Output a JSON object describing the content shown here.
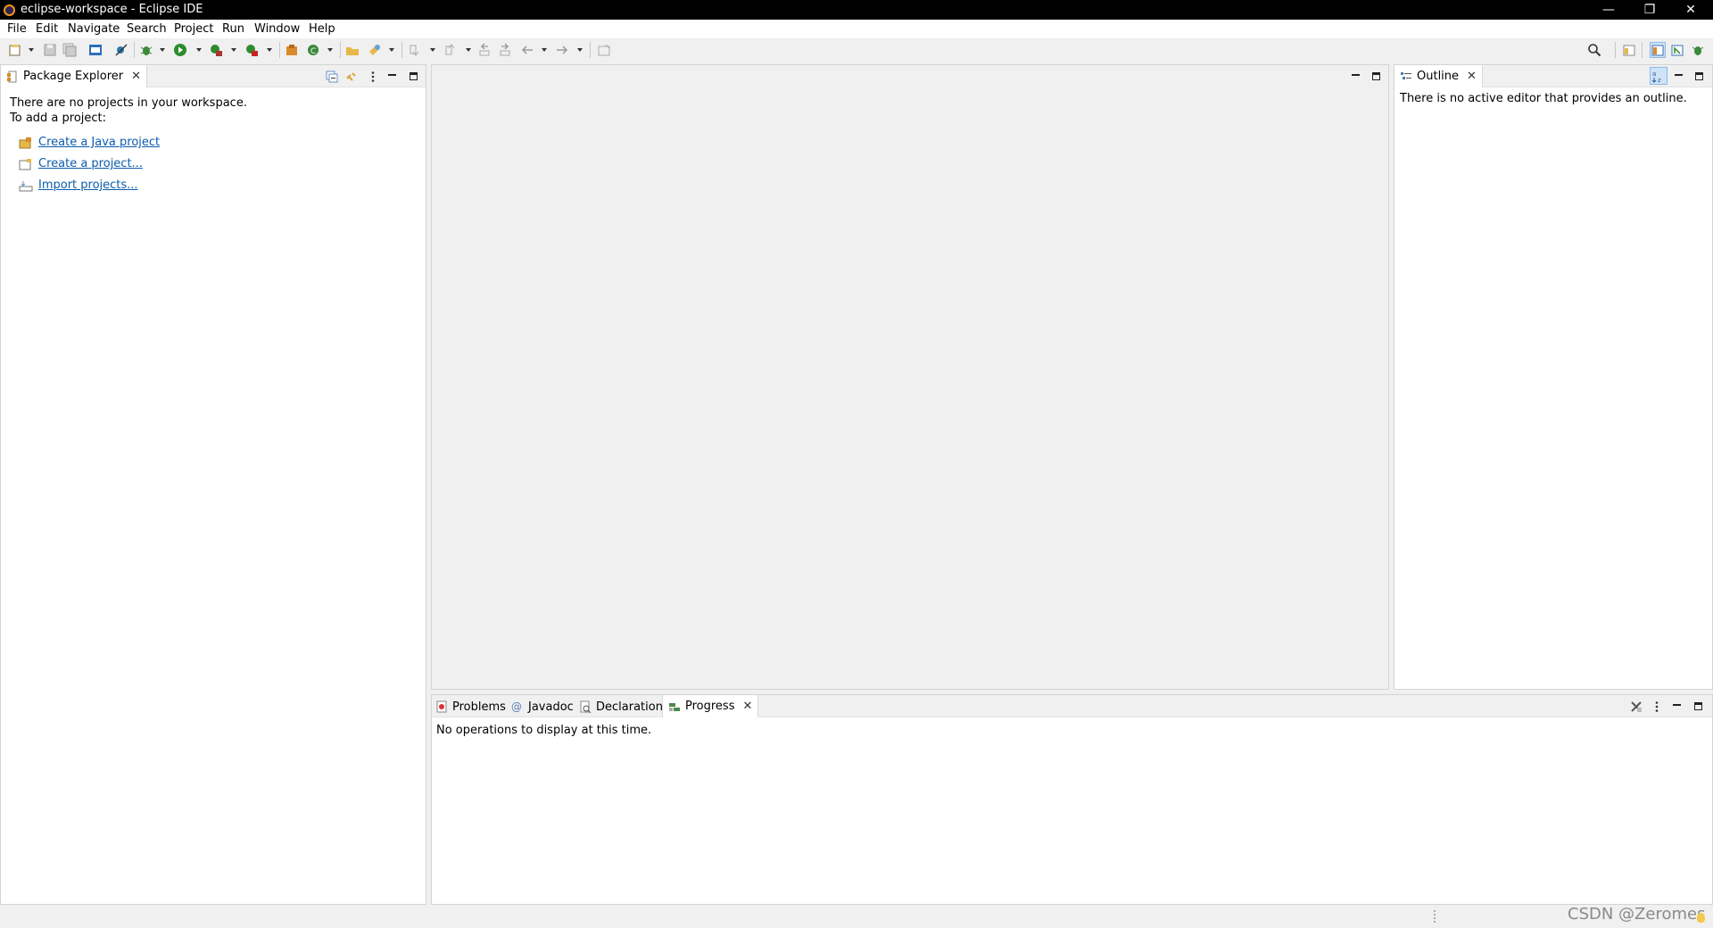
{
  "window": {
    "title": "eclipse-workspace - Eclipse IDE",
    "minimize": "—",
    "restore": "❐",
    "close": "✕"
  },
  "menu": [
    "File",
    "Edit",
    "Navigate",
    "Search",
    "Project",
    "Run",
    "Window",
    "Help"
  ],
  "package_explorer": {
    "tab_label": "Package Explorer",
    "message_line1": "There are no projects in your workspace.",
    "message_line2": "To add a project:",
    "links": [
      "Create a Java project",
      "Create a project...",
      "Import projects..."
    ]
  },
  "outline": {
    "tab_label": "Outline",
    "message": "There is no active editor that provides an outline."
  },
  "bottom_panel": {
    "tabs": [
      "Problems",
      "Javadoc",
      "Declaration",
      "Progress"
    ],
    "active_tab": "Progress",
    "message": "No operations to display at this time."
  },
  "watermark": "CSDN @Zeromes",
  "colors": {
    "link": "#0b5cad",
    "titlebar": "#000000",
    "eclipse_accent": "#f7941e"
  }
}
